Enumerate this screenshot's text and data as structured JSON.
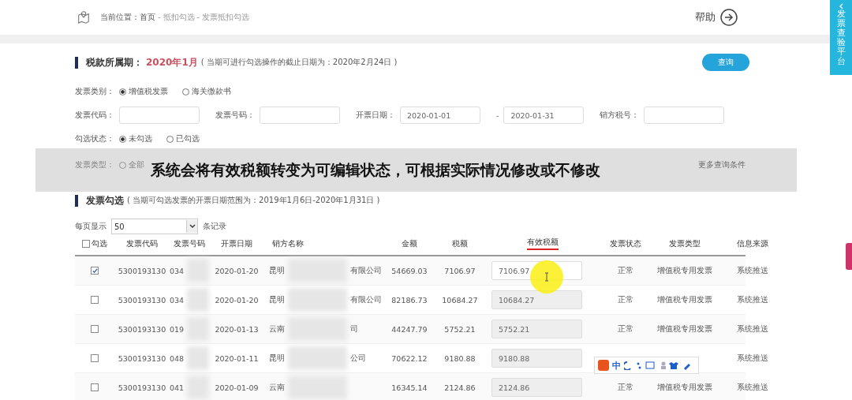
{
  "breadcrumb": {
    "label": "当前位置：",
    "separator": "-",
    "items": [
      "首页",
      "抵扣勾选",
      "发票抵扣勾选"
    ]
  },
  "help": "帮助",
  "side_tab": "发票查验平台",
  "period": {
    "label": "税款所属期：",
    "value": "2020年1月",
    "note": "( 当期可进行勾选操作的截止日期为：2020年2月24日 )"
  },
  "query_button": "查询",
  "invoice_category": {
    "label": "发票类别：",
    "options": [
      {
        "label": "增值税发票",
        "selected": true
      },
      {
        "label": "海关缴款书",
        "selected": false
      }
    ]
  },
  "fields": [
    {
      "label": "发票代码："
    },
    {
      "label": "发票号码："
    },
    {
      "label": "开票日期：",
      "value": "2020-01-01",
      "range_separator": "-",
      "to": "2020-01-31"
    },
    {
      "label": "销方税号："
    }
  ],
  "check_status": {
    "label": "勾选状态：",
    "options": [
      {
        "label": "未勾选",
        "selected": true
      },
      {
        "label": "已勾选",
        "selected": false
      }
    ]
  },
  "invoice_type": {
    "label": "发票类型：",
    "options": [
      {
        "label": "全部",
        "selected": false
      }
    ],
    "more": "更多查询条件"
  },
  "caption": "系统会将有效税额转变为可编辑状态，可根据实际情况修改或不修改",
  "selection": {
    "title": "发票勾选",
    "note": "( 当期可勾选发票的开票日期范围为：2019年1月6日-2020年1月31日 )"
  },
  "page_size": {
    "label": "每页显示",
    "value": "50",
    "suffix": "条记录"
  },
  "table": {
    "select_all_checked": false,
    "columns": [
      "勾选",
      "发票代码",
      "发票号码",
      "开票日期",
      "销方名称",
      "金额",
      "税额",
      "有效税额",
      "发票状态",
      "发票类型",
      "信息来源"
    ],
    "rows": [
      {
        "checked": true,
        "code": "5300193130",
        "number": "034",
        "date": "2020-01-20",
        "seller": "昆明",
        "seller_end": "有限公司",
        "amount": "54669.03",
        "tax": "7106.97",
        "effective_tax": "7106.97",
        "editable": true,
        "status": "正常",
        "type": "增值税专用发票",
        "source": "系统推送"
      },
      {
        "checked": false,
        "code": "5300193130",
        "number": "034",
        "date": "2020-01-20",
        "seller": "昆明",
        "seller_end": "有限公司",
        "amount": "82186.73",
        "tax": "10684.27",
        "effective_tax": "10684.27",
        "editable": false,
        "status": "正常",
        "type": "增值税专用发票",
        "source": "系统推送"
      },
      {
        "checked": false,
        "code": "5300193130",
        "number": "019",
        "date": "2020-01-13",
        "seller": "云南",
        "seller_end": "司",
        "amount": "44247.79",
        "tax": "5752.21",
        "effective_tax": "5752.21",
        "editable": false,
        "status": "正常",
        "type": "增值税专用发票",
        "source": "系统推送"
      },
      {
        "checked": false,
        "code": "5300193130",
        "number": "048",
        "date": "2020-01-11",
        "seller": "昆明",
        "seller_end": "公司",
        "amount": "70622.12",
        "tax": "9180.88",
        "effective_tax": "9180.88",
        "editable": false,
        "source": "系统推送"
      },
      {
        "checked": false,
        "code": "5300193130",
        "number": "041",
        "date": "2020-01-09",
        "seller": "云南",
        "amount": "16345.14",
        "tax": "2124.86",
        "effective_tax": "2124.86",
        "editable": false,
        "status": "正常",
        "type": "增值税专用发票",
        "source": "系统推送"
      }
    ]
  },
  "ime_bar": {
    "label": "中"
  }
}
